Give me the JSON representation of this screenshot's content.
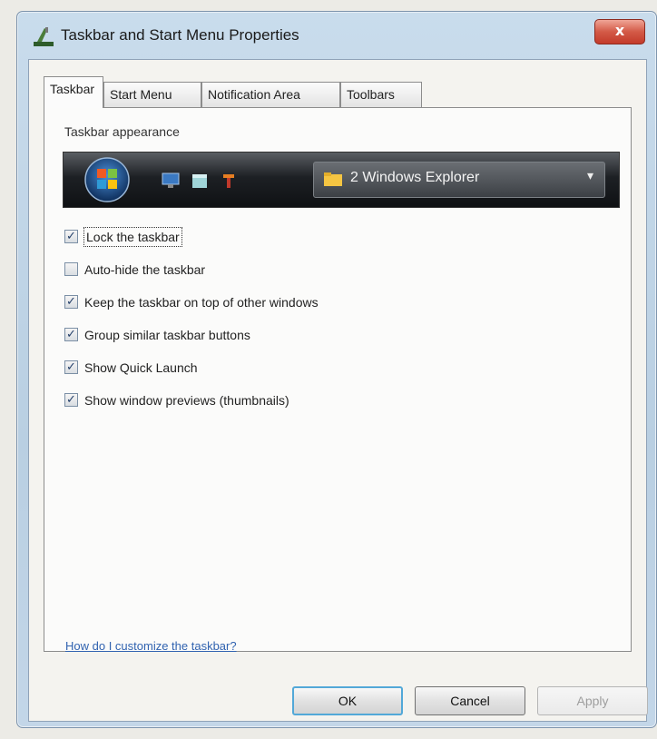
{
  "window": {
    "title": "Taskbar and Start Menu Properties",
    "close_label": "x"
  },
  "tabs": [
    {
      "label": "Taskbar",
      "active": true
    },
    {
      "label": "Start Menu",
      "active": false
    },
    {
      "label": "Notification Area",
      "active": false
    },
    {
      "label": "Toolbars",
      "active": false
    }
  ],
  "taskbar_appearance": {
    "section_label": "Taskbar appearance",
    "preview": {
      "task_button_label": "2 Windows Explorer",
      "task_button_arrow": "▾",
      "quick_launch_icons": [
        "desktop-icon",
        "folder-icon",
        "media-icon"
      ]
    }
  },
  "options": [
    {
      "label": "Lock the taskbar",
      "checked": true
    },
    {
      "label": "Auto-hide the taskbar",
      "checked": false
    },
    {
      "label": "Keep the taskbar on top of other windows",
      "checked": true
    },
    {
      "label": "Group similar taskbar buttons",
      "checked": true
    },
    {
      "label": "Show Quick Launch",
      "checked": true
    },
    {
      "label": "Show window previews (thumbnails)",
      "checked": true
    }
  ],
  "help_link": "How do I customize the taskbar?",
  "buttons": {
    "ok": "OK",
    "cancel": "Cancel",
    "apply": "Apply"
  },
  "colors": {
    "title_bar": "#c9dcec",
    "close_button": "#d35a47",
    "default_button_border": "#52a8d8",
    "link": "#3163b0"
  }
}
